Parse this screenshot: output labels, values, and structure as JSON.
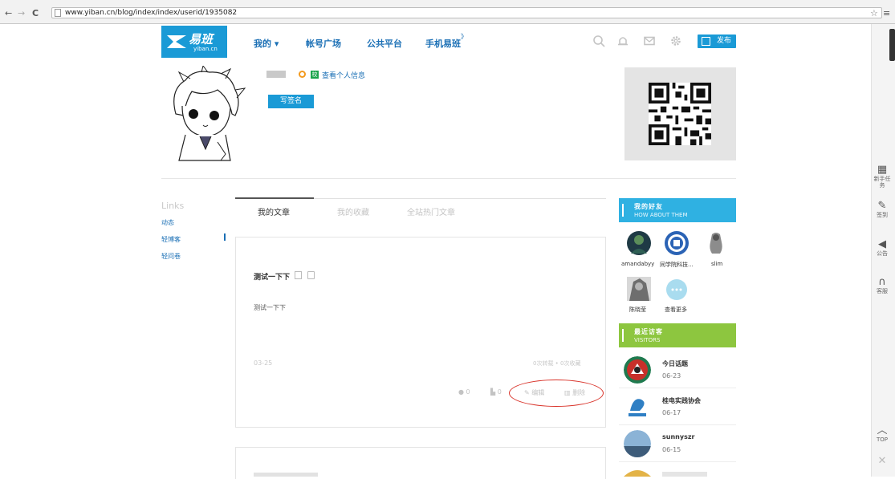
{
  "browser": {
    "back_glyph": "←",
    "forward_glyph": "→",
    "reload_glyph": "C",
    "url": "www.yiban.cn/blog/index/index/userid/1935082",
    "star_glyph": "☆",
    "menu_glyph": "≡"
  },
  "header": {
    "logo_text": "易班",
    "logo_sub": "yiban.cn",
    "nav": [
      {
        "label": "我的 ▾"
      },
      {
        "label": "帐号广场"
      },
      {
        "label": "公共平台"
      },
      {
        "label": "手机易班"
      }
    ],
    "icons": [
      "search-icon",
      "bell-icon",
      "mail-icon",
      "gear-icon"
    ],
    "publish_label": "发布",
    "accent": "#1a9ad6"
  },
  "profile": {
    "view_info": "查看个人信息",
    "school_badge": "校",
    "sign_button": "写签名"
  },
  "left_nav": {
    "title": "Links",
    "items": [
      {
        "label": "动态"
      },
      {
        "label": "轻博客"
      },
      {
        "label": "轻问卷"
      }
    ]
  },
  "tabs": [
    {
      "label": "我的文章"
    },
    {
      "label": "我的收藏"
    },
    {
      "label": "全站热门文章"
    }
  ],
  "post": {
    "title": "测试一下下",
    "body": "测试一下下",
    "date": "03-25",
    "stats": "0次转载 • 0次收藏",
    "comment_count": "0",
    "like_count": "0",
    "edit_label": "编辑",
    "delete_label": "删除",
    "highlight_color": "#d9342b"
  },
  "friends_widget": {
    "title": "我的好友",
    "subtitle": "HOW ABOUT THEM",
    "color": "#2fb1e2",
    "friends": [
      {
        "name": "amandabyy"
      },
      {
        "name": "同学院科技..."
      },
      {
        "name": "slim"
      },
      {
        "name": "陈晓莹"
      },
      {
        "name": "查看更多"
      }
    ]
  },
  "visitors_widget": {
    "title": "最近访客",
    "subtitle": "VISITORS",
    "color": "#8dc63f",
    "visitors": [
      {
        "name": "今日话题",
        "date": "06-23"
      },
      {
        "name": "桂电实践协会",
        "date": "06-17"
      },
      {
        "name": "sunnyszr",
        "date": "06-15"
      }
    ]
  },
  "side_rail": [
    {
      "glyph": "▦",
      "label": "新手任务"
    },
    {
      "glyph": "✎",
      "label": "签到"
    },
    {
      "glyph": "◀",
      "label": "公告"
    },
    {
      "glyph": "∩",
      "label": "客服"
    },
    {
      "glyph": "︿",
      "label": "TOP"
    },
    {
      "glyph": "✕",
      "label": ""
    }
  ]
}
